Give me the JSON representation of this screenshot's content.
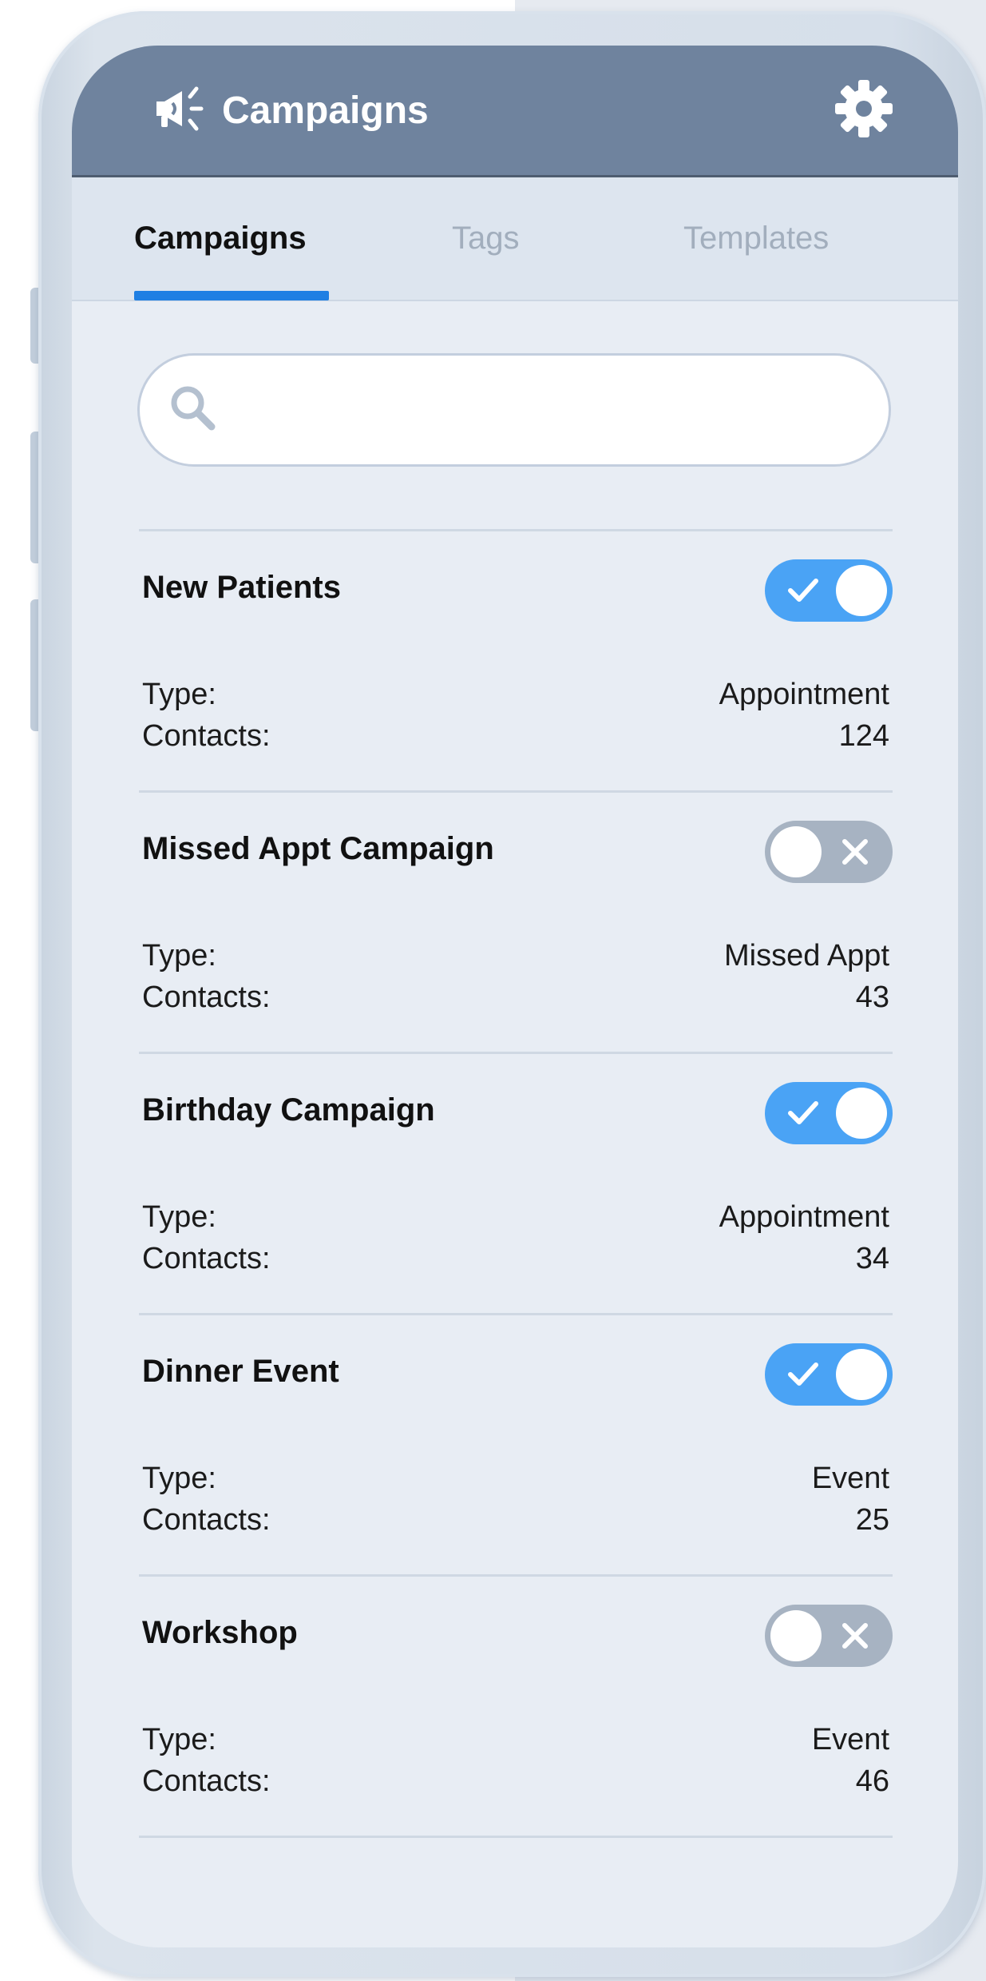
{
  "header": {
    "title": "Campaigns",
    "title_icon": "megaphone-icon",
    "settings_icon": "gear-icon"
  },
  "tabs": [
    {
      "label": "Campaigns",
      "active": true
    },
    {
      "label": "Tags",
      "active": false
    },
    {
      "label": "Templates",
      "active": false
    }
  ],
  "search": {
    "placeholder": "",
    "value": "",
    "icon": "search-icon"
  },
  "labels": {
    "type": "Type:",
    "contacts": "Contacts:"
  },
  "campaigns": [
    {
      "name": "New Patients",
      "enabled": true,
      "type": "Appointment",
      "contacts": "124"
    },
    {
      "name": "Missed Appt Campaign",
      "enabled": false,
      "type": "Missed Appt",
      "contacts": "43"
    },
    {
      "name": "Birthday Campaign",
      "enabled": true,
      "type": "Appointment",
      "contacts": "34"
    },
    {
      "name": "Dinner Event",
      "enabled": true,
      "type": "Event",
      "contacts": "25"
    },
    {
      "name": "Workshop",
      "enabled": false,
      "type": "Event",
      "contacts": "46"
    }
  ],
  "colors": {
    "header": "#6f839e",
    "tab_accent": "#1f7fe3",
    "toggle_on": "#4aa3f5",
    "toggle_off": "#a7b3c2",
    "screen_bg": "#e8edf4"
  }
}
